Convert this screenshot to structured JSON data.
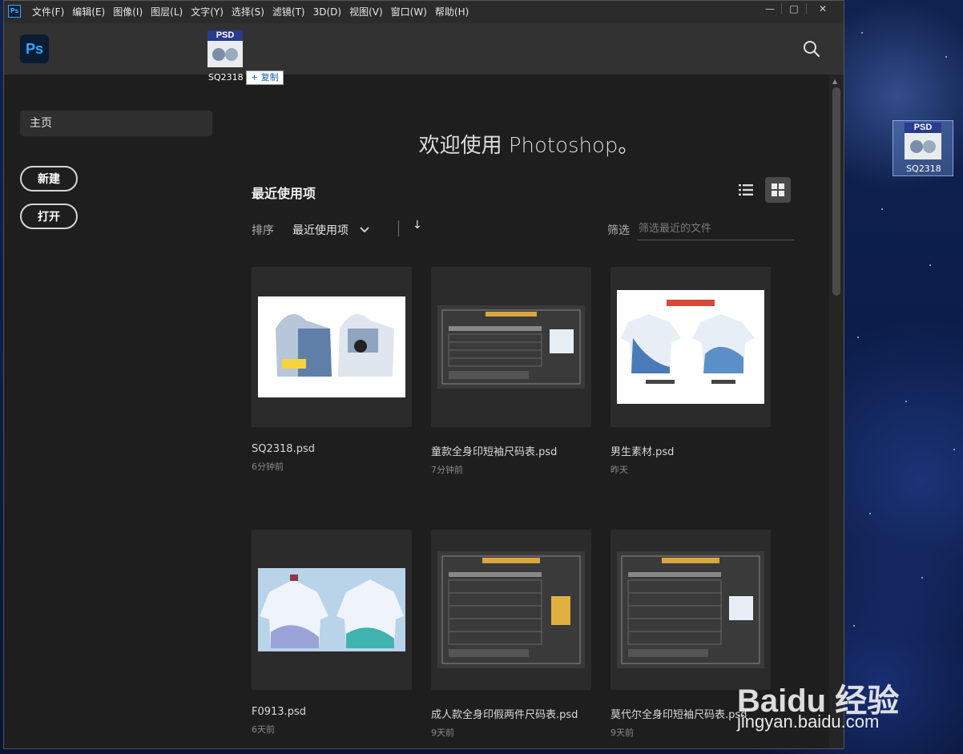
{
  "window": {
    "app_icon": "Ps",
    "menu": [
      "文件(F)",
      "编辑(E)",
      "图像(I)",
      "图层(L)",
      "文字(Y)",
      "选择(S)",
      "滤镜(T)",
      "3D(D)",
      "视图(V)",
      "窗口(W)",
      "帮助(H)"
    ],
    "controls": {
      "minimize": "—",
      "maximize": "□",
      "close": "✕"
    }
  },
  "header": {
    "logo": "Ps",
    "search_icon": "search-icon"
  },
  "sidebar": {
    "home": "主页",
    "new_button": "新建",
    "open_button": "打开"
  },
  "main": {
    "welcome": "欢迎使用 Photoshop。",
    "recent_title": "最近使用项",
    "sort_label": "排序",
    "sort_value": "最近使用项",
    "sort_direction": "↓",
    "filter_label": "筛选",
    "filter_placeholder": "筛选最近的文件",
    "files": [
      {
        "name": "SQ2318.psd",
        "time": "6分钟前"
      },
      {
        "name": "童款全身印短袖尺码表.psd",
        "time": "7分钟前"
      },
      {
        "name": "男生素材.psd",
        "time": "昨天"
      },
      {
        "name": "F0913.psd",
        "time": "6天前"
      },
      {
        "name": "成人款全身印假两件尺码表.psd",
        "time": "9天前"
      },
      {
        "name": "莫代尔全身印短袖尺码表.psd",
        "time": "9天前"
      }
    ]
  },
  "drag": {
    "badge": "PSD",
    "name": "SQ2318",
    "tooltip_icon": "+",
    "tooltip": "复制"
  },
  "desktop_file": {
    "badge": "PSD",
    "name": "SQ2318"
  },
  "watermark": {
    "brand": "Baidu 经验",
    "url": "jingyan.baidu.com"
  }
}
